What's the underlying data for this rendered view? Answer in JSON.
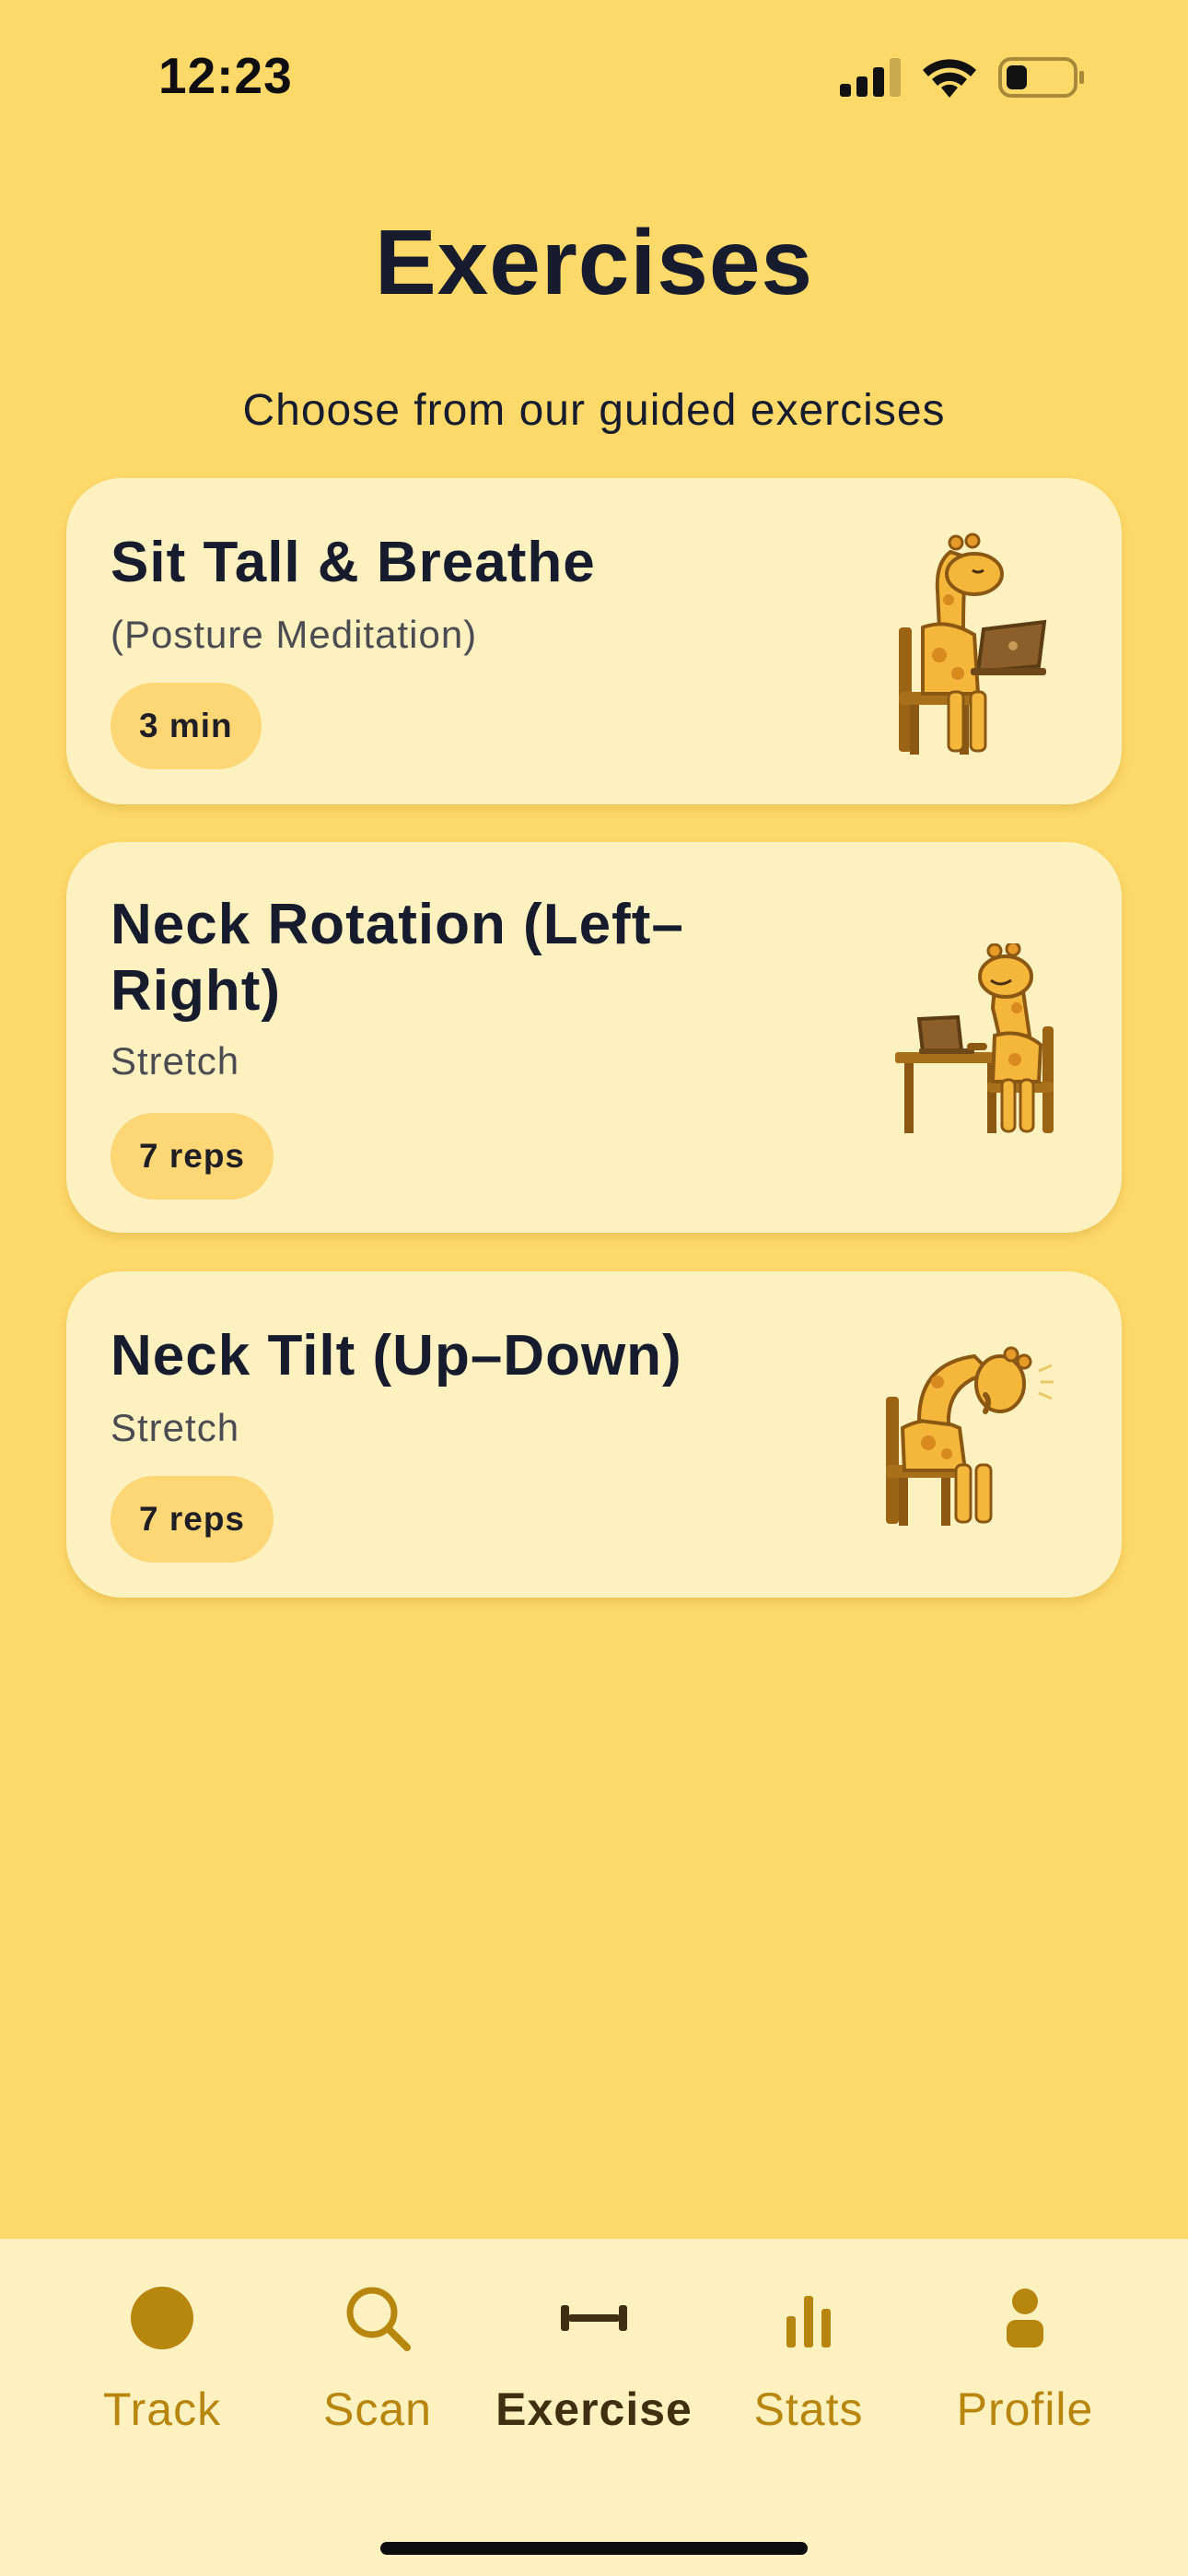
{
  "status_bar": {
    "time": "12:23"
  },
  "header": {
    "title": "Exercises",
    "subtitle": "Choose from our guided exercises"
  },
  "exercises": [
    {
      "title": "Sit Tall & Breathe",
      "subtitle": "(Posture Meditation)",
      "badge": "3 min",
      "illustration": "giraffe-at-laptop-icon"
    },
    {
      "title": "Neck Rotation (Left–Right)",
      "subtitle": "Stretch",
      "badge": "7 reps",
      "illustration": "giraffe-at-desk-icon"
    },
    {
      "title": "Neck Tilt (Up–Down)",
      "subtitle": "Stretch",
      "badge": "7 reps",
      "illustration": "giraffe-neck-tilt-icon"
    }
  ],
  "tab_bar": {
    "tabs": [
      {
        "label": "Track",
        "icon": "circle-icon"
      },
      {
        "label": "Scan",
        "icon": "search-icon"
      },
      {
        "label": "Exercise",
        "icon": "dumbbell-icon",
        "active": true
      },
      {
        "label": "Stats",
        "icon": "bar-chart-icon"
      },
      {
        "label": "Profile",
        "icon": "person-icon"
      }
    ]
  },
  "colors": {
    "background": "#FDD96A",
    "card": "#FEF1C0",
    "pill": "#FDD675",
    "tab_inactive": "#B7860F",
    "tab_active": "#3E2F10",
    "text_dark": "#161C2E"
  }
}
